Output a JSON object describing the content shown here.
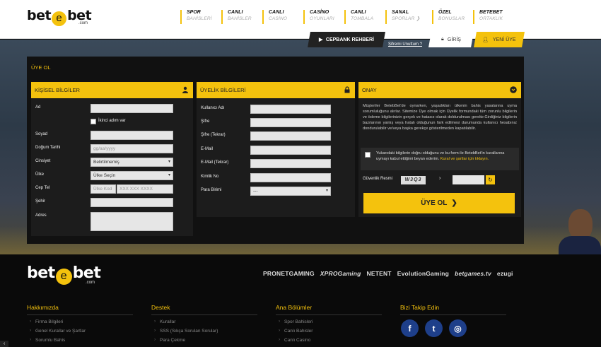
{
  "brand": {
    "logo_left": "bet",
    "logo_mid": "e",
    "logo_right": "bet",
    "logo_sub": ".com",
    "accent": "#f4c20d"
  },
  "nav": [
    {
      "top": "SPOR",
      "sub": "BAHİSLERİ"
    },
    {
      "top": "CANLI",
      "sub": "BAHİSLER"
    },
    {
      "top": "CANLI",
      "sub": "CASİNO"
    },
    {
      "top": "CASİNO",
      "sub": "OYUNLARI"
    },
    {
      "top": "CANLI",
      "sub": "TOMBALA"
    },
    {
      "top": "SANAL",
      "sub": "SPORLAR ❯"
    },
    {
      "top": "ÖZEL",
      "sub": "BONUSLAR"
    },
    {
      "top": "BETEBET",
      "sub": "ORTAKLIK"
    }
  ],
  "header_actions": {
    "cepbank": "CEPBANK REHBERİ",
    "forgot": "Şifremi Unuttum ?",
    "login": "GİRİŞ",
    "register": "YENİ ÜYE"
  },
  "form": {
    "title": "ÜYE OL",
    "personal": {
      "heading": "KİŞİSEL BİLGİLER",
      "ad": "Ad",
      "ikinci": "İkinci adım var",
      "soyad": "Soyad",
      "dogum": "Doğum Tarihi",
      "dogum_placeholder": "gg/aa/yyyy",
      "cinsiyet": "Cinsiyet",
      "cinsiyet_value": "Belirtilmemiş",
      "ulke": "Ülke",
      "ulke_value": "Ülke Seçin",
      "cep": "Cep Tel",
      "cep_kod": "Ülke Kod",
      "cep_placeholder": "XXX XXX XXXX",
      "sehir": "Şehir",
      "adres": "Adres"
    },
    "membership": {
      "heading": "ÜYELİK BİLGİLERİ",
      "kullanici": "Kullanıcı Adı",
      "sifre": "Şifre",
      "sifre_tekrar": "Şifre (Tekrar)",
      "email": "E-Mail",
      "email_tekrar": "E-Mail (Tekrar)",
      "kimlik": "Kimlik No",
      "para": "Para Birimi",
      "para_value": "---"
    },
    "onay": {
      "heading": "ONAY",
      "text": "Müşteriler BetebBet'de oynarken, yaşadıkları ülkenin bahis yasalarına uyma sorumluluğunu alırlar. Sitemize Üye olmak için Üyelik formundaki tüm zorunlu bilgilerin ve ödeme bilgilerinizin gerçek ve hatasız olarak doldurulması gerekir.Girdiğiniz bilgilerin bazılarının yanlış veya hatalı olduğunun fark edilmesi durumunda kullanıcı hesabınız dondurulabilir ve/veya başka gerekçe gösterilmeden kapatılabilir.",
      "check_text": "Yukarıdaki bilgilerin doğru olduğunu ve bu form ile BetebBet'in kurallarına uymayı kabul ettiğimi beyan ederim.",
      "check_link": "Kural ve şartlar için tıklayın.",
      "captcha_label": "Güvenlik Resmi",
      "captcha_code": "W3Q3",
      "submit": "ÜYE OL"
    }
  },
  "footer": {
    "providers": [
      "PRONETGAMING",
      "XPROGaming",
      "NETENT",
      "EvolutionGaming",
      "betgames.tv",
      "ezugi"
    ],
    "columns": [
      {
        "title": "Hakkımızda",
        "items": [
          "Firma Bilgileri",
          "Genel Kurallar ve Şartlar",
          "Sorumlu Bahis"
        ]
      },
      {
        "title": "Destek",
        "items": [
          "Kurallar",
          "SSS (Sıkça Sorulan Sorular)",
          "Para Çekme"
        ]
      },
      {
        "title": "Ana Bölümler",
        "items": [
          "Spor Bahisleri",
          "Canlı Bahisler",
          "Canlı Casino"
        ]
      }
    ],
    "social_title": "Bizi Takip Edin",
    "social": [
      "f",
      "t",
      "◎"
    ]
  }
}
